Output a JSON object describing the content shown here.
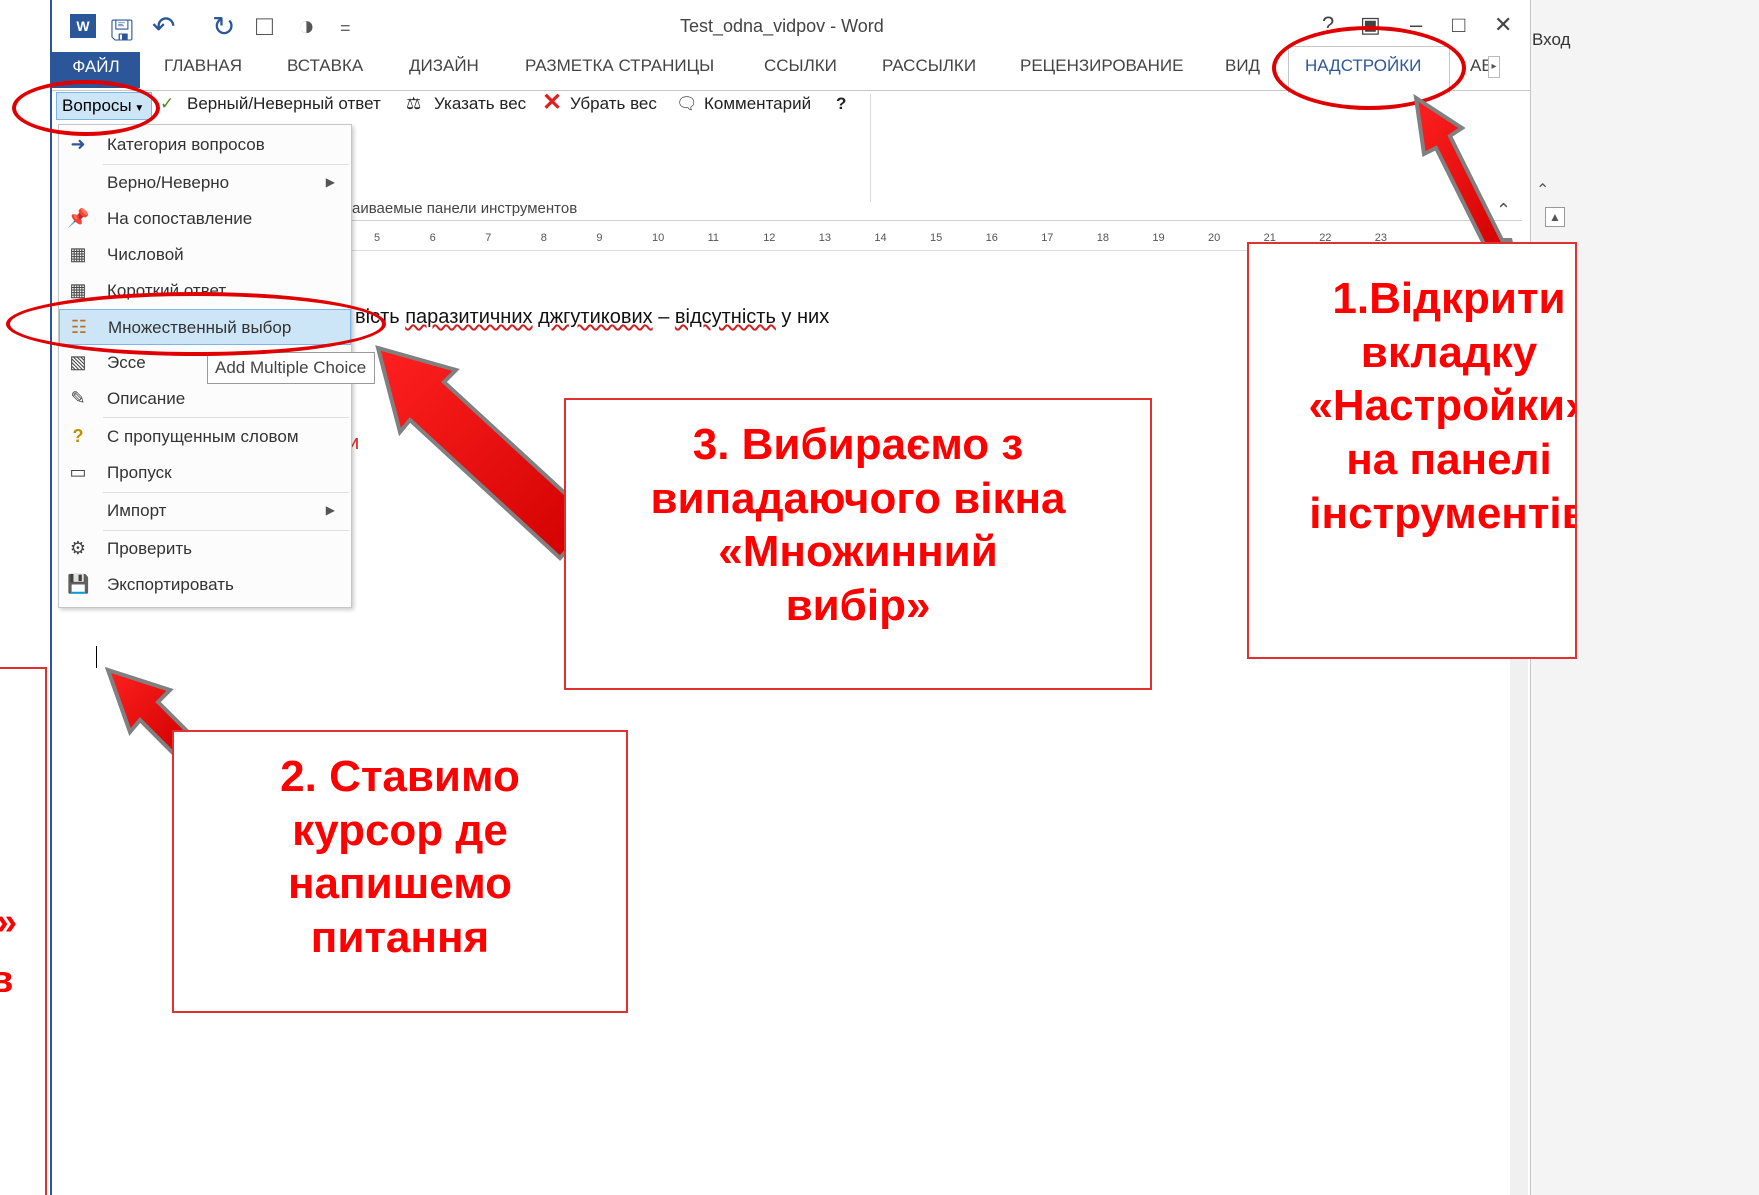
{
  "window": {
    "doc_title": "Test_odna_vidpov - Word",
    "sign_in": "Вход",
    "controls": [
      "?",
      "▣",
      "–",
      "□",
      "✕"
    ]
  },
  "quick_access": [
    "save-icon",
    "undo-icon",
    "redo-icon",
    "new-icon",
    "print-preview-icon"
  ],
  "tabs": [
    "ФАЙЛ",
    "ГЛАВНАЯ",
    "ВСТАВКА",
    "ДИЗАЙН",
    "РАЗМЕТКА СТРАНИЦЫ",
    "ССЫЛКИ",
    "РАССЫЛКИ",
    "РЕЦЕНЗИРОВАНИЕ",
    "ВИД",
    "НАДСТРОЙКИ",
    "ABBY"
  ],
  "toolbar": {
    "questions": "Вопросы",
    "true_false": "Верный/Неверный ответ",
    "set_weight": "Указать вес",
    "remove_weight": "Убрать вес",
    "comment": "Комментарий",
    "custom_toolbars": "аиваемые панели инструментов"
  },
  "ruler": [
    "5",
    "6",
    "7",
    "8",
    "9",
    "10",
    "11",
    "12",
    "13",
    "14",
    "15",
    "16",
    "17",
    "18",
    "19",
    "20",
    "21",
    "22",
    "23"
  ],
  "menu": [
    {
      "label": "Категория вопросов",
      "icon": "arrow-right-icon"
    },
    {
      "label": "Верно/Неверно",
      "icon": "",
      "submenu": true
    },
    {
      "label": "На сопоставление",
      "icon": "pin-icon"
    },
    {
      "label": "Числовой",
      "icon": "calculator-icon"
    },
    {
      "label": "Короткий ответ",
      "icon": "short-answer-icon"
    },
    {
      "label": "Множественный выбор",
      "icon": "hierarchy-icon"
    },
    {
      "label": "Эссе",
      "icon": "essay-icon"
    },
    {
      "label": "Описание",
      "icon": "pencil-icon"
    },
    {
      "label": "С пропущенным словом",
      "icon": "question-icon"
    },
    {
      "label": "Пропуск",
      "icon": "blank-icon"
    },
    {
      "label": "Импорт",
      "icon": "",
      "submenu": true
    },
    {
      "label": "Проверить",
      "icon": "gears-icon"
    },
    {
      "label": "Экспортировать",
      "icon": "floppy-icon"
    }
  ],
  "tooltip": "Add Multiple Choice",
  "document": {
    "line_prefix": "вість ",
    "line_word1": "паразитичних",
    "line_word2": "джгутикових",
    "line_dash": " – ",
    "line_word3": "відсутність",
    "line_rest": " у них",
    "red_fragment": "и"
  },
  "annotations": {
    "step1": [
      "1.Відкрити",
      "вкладку",
      "«Настройки»",
      "на панелі",
      "інструментів"
    ],
    "step2": [
      "2. Ставимо",
      "курсор де",
      "напишемо",
      "питання"
    ],
    "step3": [
      "3. Вибираємо  з",
      "випадаючого вікна",
      "«Множинний",
      "вибір»"
    ],
    "left_fragment": [
      "»",
      "в"
    ]
  },
  "colors": {
    "accent": "#2b579a",
    "annotation_red": "#ff0000",
    "highlight": "#cde6f7"
  }
}
